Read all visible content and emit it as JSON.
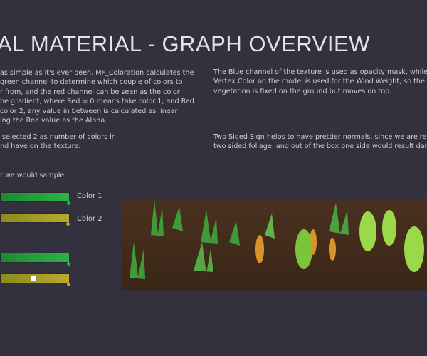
{
  "title": "AL MATERIAL - GRAPH OVERVIEW",
  "left_text": {
    "p1": "as simple as it's ever been, MF_Coloration calculates the\ngreen channel to determine which couple of colors to\nr from, and the red channel can be seen as the color\nhe gradient, where Red = 0 means take color 1, and Red\ncolor 2, any value in between is calculated as linear\ning the Red value as the Alpha.",
    "p2": " selected 2 as number of colors in\nnd have on the texture:",
    "p3": "r we would sample:"
  },
  "right_text": {
    "p1": "The Blue channel of the texture is used as opacity mask, while th\nVertex Color on the model is used for the Wind Weight, so the\nvegetation is fixed on the ground but moves on top.",
    "p2": "Two Sided Sign helps to have prettier normals, since we are rend\ntwo sided foliage  and out of the box one side would result darke"
  },
  "swatches": {
    "color1_label": "Color 1",
    "color2_label": "Color 2",
    "green": "#2cb547",
    "yellow": "#b8aa2e",
    "sample_alpha": 0.5
  }
}
